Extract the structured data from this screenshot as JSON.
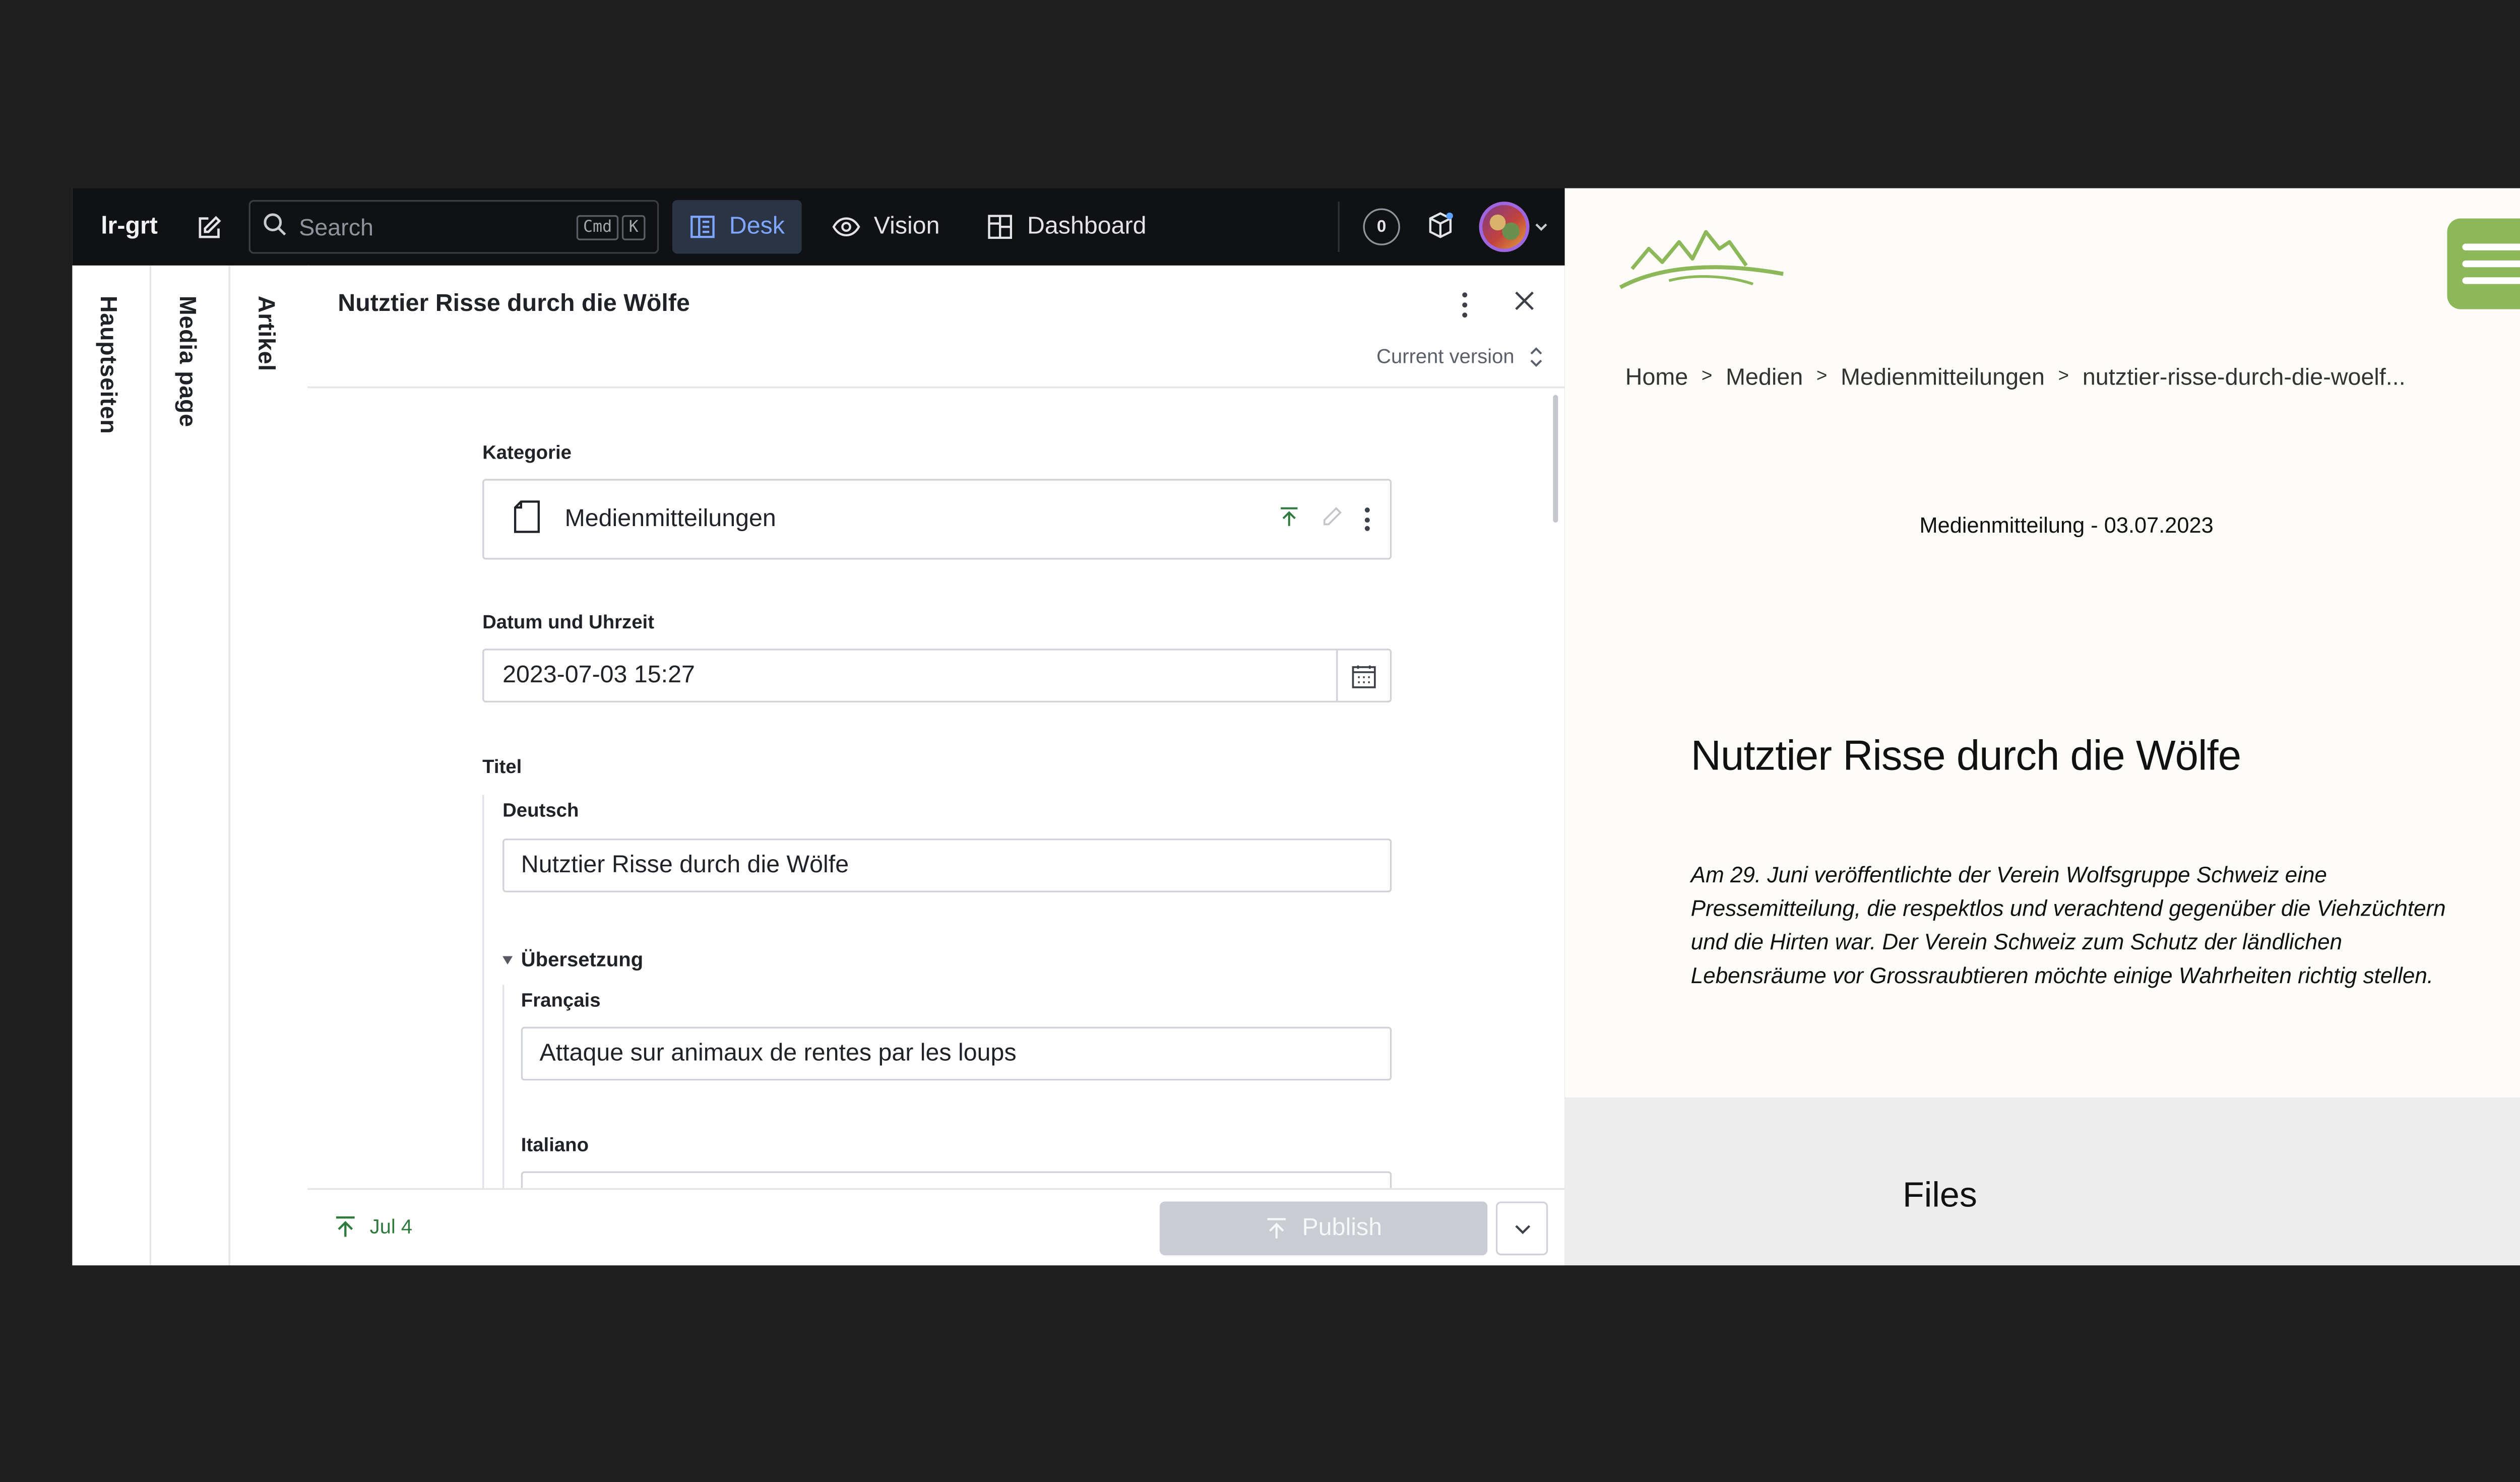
{
  "studio": {
    "project_name": "lr-grt",
    "search": {
      "placeholder": "Search",
      "shortcut_mod": "Cmd",
      "shortcut_key": "K"
    },
    "tools": [
      {
        "label": "Desk",
        "icon": "desk-icon",
        "active": true
      },
      {
        "label": "Vision",
        "icon": "eye-icon",
        "active": false
      },
      {
        "label": "Dashboard",
        "icon": "dashboard-icon",
        "active": false
      }
    ],
    "status_count": "0",
    "accent_color": "#7fa7ff",
    "panes": [
      "Hauptseiten",
      "Media page",
      "Artikel"
    ],
    "document": {
      "title": "Nutztier Risse durch die Wölfe",
      "version": "Current version",
      "fields": {
        "kategorie_label": "Kategorie",
        "kategorie_value": "Medienmitteilungen",
        "datum_label": "Datum und Uhrzeit",
        "datum_value": "2023-07-03 15:27",
        "titel_label": "Titel",
        "deutsch_label": "Deutsch",
        "deutsch_value": "Nutztier Risse durch die Wölfe",
        "uebersetzung_label": "Übersetzung",
        "francais_label": "Français",
        "francais_value": "Attaque sur animaux de rentes par les loups",
        "italiano_label": "Italiano"
      },
      "footer": {
        "status": "Jul 4",
        "publish_label": "Publish"
      }
    }
  },
  "preview": {
    "brand_color": "#8cb85a",
    "breadcrumb": [
      "Home",
      "Medien",
      "Medienmitteilungen",
      "nutztier-risse-durch-die-woelf..."
    ],
    "breadcrumb_sep": ">",
    "dateline": "Medienmitteilung - 03.07.2023",
    "title": "Nutztier Risse durch die Wölfe",
    "lead": "Am 29. Juni veröffentlichte der Verein Wolfsgruppe Schweiz eine Pressemitteilung, die respektlos und verachtend gegenüber die Viehzüchtern und die Hirten war. Der Verein Schweiz zum Schutz der ländlichen Lebensräume vor Grossraubtieren möchte einige Wahrheiten richtig stellen.",
    "files_title": "Files"
  }
}
